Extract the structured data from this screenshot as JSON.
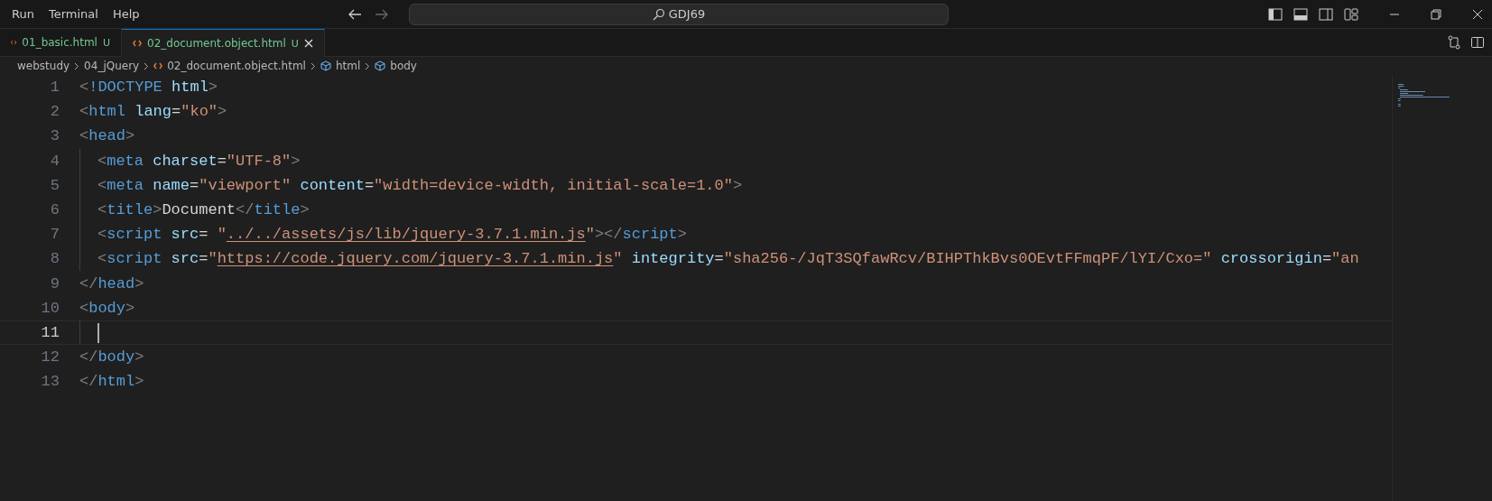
{
  "menu": [
    "Run",
    "Terminal",
    "Help"
  ],
  "search": {
    "value": "GDJ69"
  },
  "tabs": [
    {
      "label": "01_basic.html",
      "badge": "U",
      "selected": false
    },
    {
      "label": "02_document.object.html",
      "badge": "U",
      "selected": true
    }
  ],
  "breadcrumb": [
    {
      "kind": "folder",
      "label": "webstudy"
    },
    {
      "kind": "folder",
      "label": "04_jQuery"
    },
    {
      "kind": "file",
      "label": "02_document.object.html"
    },
    {
      "kind": "element",
      "label": "html"
    },
    {
      "kind": "element",
      "label": "body"
    }
  ],
  "lines": [
    {
      "number": "1",
      "current": false,
      "indented": false,
      "tokens": [
        {
          "kind": "p",
          "text": "<"
        },
        {
          "kind": "tag",
          "text": "!DOCTYPE"
        },
        {
          "kind": "attr",
          "text": " html"
        },
        {
          "kind": "p",
          "text": ">"
        }
      ]
    },
    {
      "number": "2",
      "current": false,
      "indented": false,
      "tokens": [
        {
          "kind": "p",
          "text": "<"
        },
        {
          "kind": "tag",
          "text": "html"
        },
        {
          "kind": "attr",
          "text": " lang"
        },
        {
          "kind": "text",
          "text": "="
        },
        {
          "kind": "str",
          "text": "\"ko\""
        },
        {
          "kind": "p",
          "text": ">"
        }
      ]
    },
    {
      "number": "3",
      "current": false,
      "indented": false,
      "tokens": [
        {
          "kind": "p",
          "text": "<"
        },
        {
          "kind": "tag",
          "text": "head"
        },
        {
          "kind": "p",
          "text": ">"
        }
      ]
    },
    {
      "number": "4",
      "current": false,
      "indented": true,
      "tokens": [
        {
          "kind": "p",
          "text": "<"
        },
        {
          "kind": "tag",
          "text": "meta"
        },
        {
          "kind": "attr",
          "text": " charset"
        },
        {
          "kind": "text",
          "text": "="
        },
        {
          "kind": "str",
          "text": "\"UTF-8\""
        },
        {
          "kind": "p",
          "text": ">"
        }
      ]
    },
    {
      "number": "5",
      "current": false,
      "indented": true,
      "tokens": [
        {
          "kind": "p",
          "text": "<"
        },
        {
          "kind": "tag",
          "text": "meta"
        },
        {
          "kind": "attr",
          "text": " name"
        },
        {
          "kind": "text",
          "text": "="
        },
        {
          "kind": "str",
          "text": "\"viewport\""
        },
        {
          "kind": "attr",
          "text": " content"
        },
        {
          "kind": "text",
          "text": "="
        },
        {
          "kind": "str",
          "text": "\"width=device-width, initial-scale=1.0\""
        },
        {
          "kind": "p",
          "text": ">"
        }
      ]
    },
    {
      "number": "6",
      "current": false,
      "indented": true,
      "tokens": [
        {
          "kind": "p",
          "text": "<"
        },
        {
          "kind": "tag",
          "text": "title"
        },
        {
          "kind": "p",
          "text": ">"
        },
        {
          "kind": "text",
          "text": "Document"
        },
        {
          "kind": "p",
          "text": "</"
        },
        {
          "kind": "tag",
          "text": "title"
        },
        {
          "kind": "p",
          "text": ">"
        }
      ]
    },
    {
      "number": "7",
      "current": false,
      "indented": true,
      "tokens": [
        {
          "kind": "p",
          "text": "<"
        },
        {
          "kind": "tag",
          "text": "script"
        },
        {
          "kind": "attr",
          "text": " src"
        },
        {
          "kind": "text",
          "text": "= "
        },
        {
          "kind": "str",
          "text": "\""
        },
        {
          "kind": "link",
          "text": "../../assets/js/lib/jquery-3.7.1.min.js"
        },
        {
          "kind": "str",
          "text": "\""
        },
        {
          "kind": "p",
          "text": "></"
        },
        {
          "kind": "tag",
          "text": "script"
        },
        {
          "kind": "p",
          "text": ">"
        }
      ]
    },
    {
      "number": "8",
      "current": false,
      "indented": true,
      "tokens": [
        {
          "kind": "p",
          "text": "<"
        },
        {
          "kind": "tag",
          "text": "script"
        },
        {
          "kind": "attr",
          "text": " src"
        },
        {
          "kind": "text",
          "text": "="
        },
        {
          "kind": "str",
          "text": "\""
        },
        {
          "kind": "link",
          "text": "https://code.jquery.com/jquery-3.7.1.min.js"
        },
        {
          "kind": "str",
          "text": "\""
        },
        {
          "kind": "attr",
          "text": " integrity"
        },
        {
          "kind": "text",
          "text": "="
        },
        {
          "kind": "str",
          "text": "\"sha256-/JqT3SQfawRcv/BIHPThkBvs0OEvtFFmqPF/lYI/Cxo=\""
        },
        {
          "kind": "attr",
          "text": " crossorigin"
        },
        {
          "kind": "text",
          "text": "="
        },
        {
          "kind": "str",
          "text": "\"an"
        }
      ]
    },
    {
      "number": "9",
      "current": false,
      "indented": false,
      "tokens": [
        {
          "kind": "p",
          "text": "</"
        },
        {
          "kind": "tag",
          "text": "head"
        },
        {
          "kind": "p",
          "text": ">"
        }
      ]
    },
    {
      "number": "10",
      "current": false,
      "indented": false,
      "tokens": [
        {
          "kind": "p",
          "text": "<"
        },
        {
          "kind": "tag",
          "text": "body"
        },
        {
          "kind": "p",
          "text": ">"
        }
      ]
    },
    {
      "number": "11",
      "current": true,
      "indented": true
    },
    {
      "number": "12",
      "current": false,
      "indented": false,
      "tokens": [
        {
          "kind": "p",
          "text": "</"
        },
        {
          "kind": "tag",
          "text": "body"
        },
        {
          "kind": "p",
          "text": ">"
        }
      ]
    },
    {
      "number": "13",
      "current": false,
      "indented": false,
      "tokens": [
        {
          "kind": "p",
          "text": "</"
        },
        {
          "kind": "tag",
          "text": "html"
        },
        {
          "kind": "p",
          "text": ">"
        }
      ]
    }
  ]
}
